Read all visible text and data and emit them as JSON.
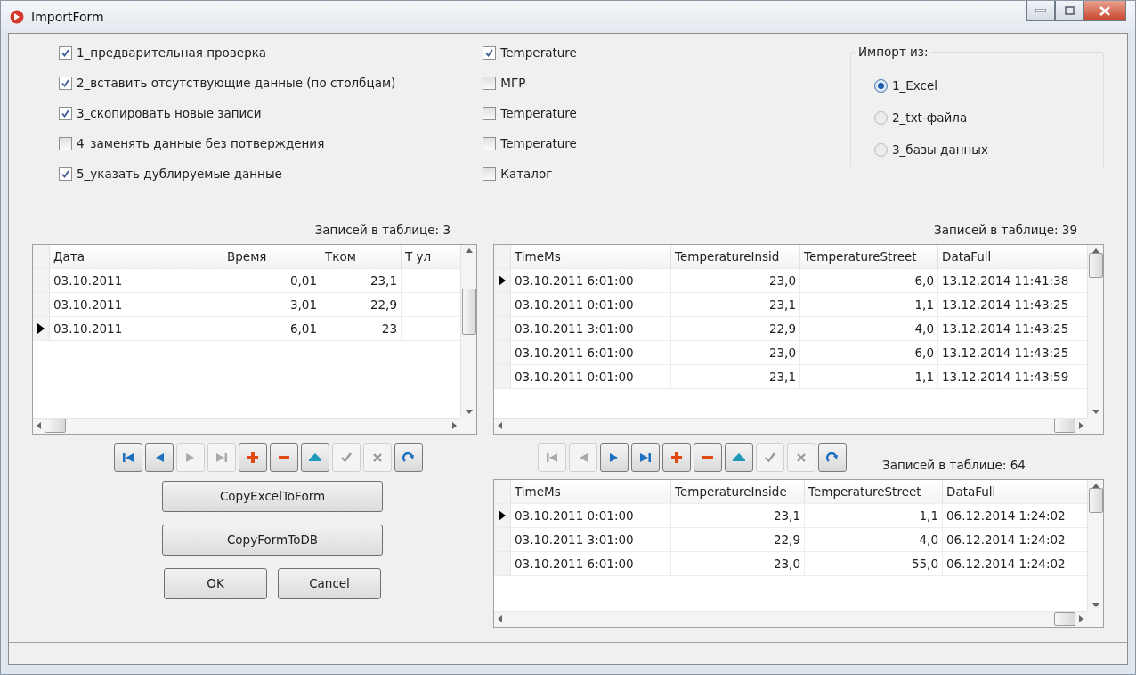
{
  "window": {
    "title": "ImportForm"
  },
  "options": [
    {
      "label": "1_предварительная проверка",
      "checked": true
    },
    {
      "label": "2_вставить отсутствующие данные (по столбцам)",
      "checked": true
    },
    {
      "label": "3_скопировать новые записи",
      "checked": true
    },
    {
      "label": "4_заменять данные без потверждения",
      "checked": false
    },
    {
      "label": "5_указать дублируемые данные",
      "checked": true
    }
  ],
  "tables_filter": [
    {
      "label": "Temperature",
      "checked": true
    },
    {
      "label": "МГР",
      "checked": false
    },
    {
      "label": "Temperature",
      "checked": false
    },
    {
      "label": "Temperature",
      "checked": false
    },
    {
      "label": "Каталог",
      "checked": false
    }
  ],
  "import_from": {
    "title": "Импорт из:",
    "options": [
      {
        "label": "1_Excel",
        "selected": true
      },
      {
        "label": "2_txt-файла",
        "selected": false
      },
      {
        "label": "3_базы данных",
        "selected": false
      }
    ]
  },
  "left": {
    "count": "Записей в таблице: 3",
    "grid": {
      "columns": [
        {
          "label": "Дата",
          "kind": "text"
        },
        {
          "label": "Время",
          "kind": "number"
        },
        {
          "label": "Tком",
          "kind": "number"
        },
        {
          "label": "Т ул",
          "kind": "number"
        }
      ],
      "rows": [
        {
          "selected": false,
          "cells": [
            "03.10.2011",
            "0,01",
            "23,1"
          ]
        },
        {
          "selected": false,
          "cells": [
            "03.10.2011",
            "3,01",
            "22,9"
          ]
        },
        {
          "selected": true,
          "cells": [
            "03.10.2011",
            "6,01",
            "23"
          ]
        }
      ]
    },
    "navigator": [
      {
        "kind": "first",
        "disabled": false
      },
      {
        "kind": "prior",
        "disabled": false
      },
      {
        "kind": "next",
        "disabled": true
      },
      {
        "kind": "last",
        "disabled": true
      },
      {
        "kind": "insert",
        "disabled": false
      },
      {
        "kind": "delete",
        "disabled": false
      },
      {
        "kind": "edit",
        "disabled": false
      },
      {
        "kind": "post",
        "disabled": true
      },
      {
        "kind": "cancel",
        "disabled": true
      },
      {
        "kind": "refresh",
        "disabled": false
      }
    ],
    "buttons": [
      "CopyExcelToForm",
      "CopyFormToDB"
    ],
    "ok": "OK",
    "cancel": "Cancel"
  },
  "right": {
    "count": "Записей в таблице: 39",
    "grid": {
      "columns": [
        {
          "label": "TimeMs",
          "kind": "text"
        },
        {
          "label": "TemperatureInsid",
          "kind": "number"
        },
        {
          "label": "TemperatureStreet",
          "kind": "number"
        },
        {
          "label": "DataFull",
          "kind": "text"
        }
      ],
      "rows": [
        {
          "selected": true,
          "cells": [
            "03.10.2011 6:01:00",
            "23,0",
            "6,0",
            "13.12.2014 11:41:38"
          ]
        },
        {
          "selected": false,
          "cells": [
            "03.10.2011 0:01:00",
            "23,1",
            "1,1",
            "13.12.2014 11:43:25"
          ]
        },
        {
          "selected": false,
          "cells": [
            "03.10.2011 3:01:00",
            "22,9",
            "4,0",
            "13.12.2014 11:43:25"
          ]
        },
        {
          "selected": false,
          "cells": [
            "03.10.2011 6:01:00",
            "23,0",
            "6,0",
            "13.12.2014 11:43:25"
          ]
        },
        {
          "selected": false,
          "cells": [
            "03.10.2011 0:01:00",
            "23,1",
            "1,1",
            "13.12.2014 11:43:59"
          ]
        }
      ]
    },
    "navigator": [
      {
        "kind": "first",
        "disabled": true
      },
      {
        "kind": "prior",
        "disabled": true
      },
      {
        "kind": "next",
        "disabled": false
      },
      {
        "kind": "last",
        "disabled": false
      },
      {
        "kind": "insert",
        "disabled": false
      },
      {
        "kind": "delete",
        "disabled": false
      },
      {
        "kind": "edit",
        "disabled": false
      },
      {
        "kind": "post",
        "disabled": true
      },
      {
        "kind": "cancel",
        "disabled": true
      },
      {
        "kind": "refresh",
        "disabled": false
      }
    ],
    "count2": "Записей в таблице: 64",
    "grid2": {
      "columns": [
        {
          "label": "TimeMs",
          "kind": "text"
        },
        {
          "label": "TemperatureInside",
          "kind": "number"
        },
        {
          "label": "TemperatureStreet",
          "kind": "number"
        },
        {
          "label": "DataFull",
          "kind": "text"
        }
      ],
      "rows": [
        {
          "selected": true,
          "cells": [
            "03.10.2011 0:01:00",
            "23,1",
            "1,1",
            "06.12.2014 1:24:02"
          ]
        },
        {
          "selected": false,
          "cells": [
            "03.10.2011 3:01:00",
            "22,9",
            "4,0",
            "06.12.2014 1:24:02"
          ]
        },
        {
          "selected": false,
          "cells": [
            "03.10.2011 6:01:00",
            "23,0",
            "55,0",
            "06.12.2014 1:24:02"
          ]
        }
      ]
    }
  }
}
